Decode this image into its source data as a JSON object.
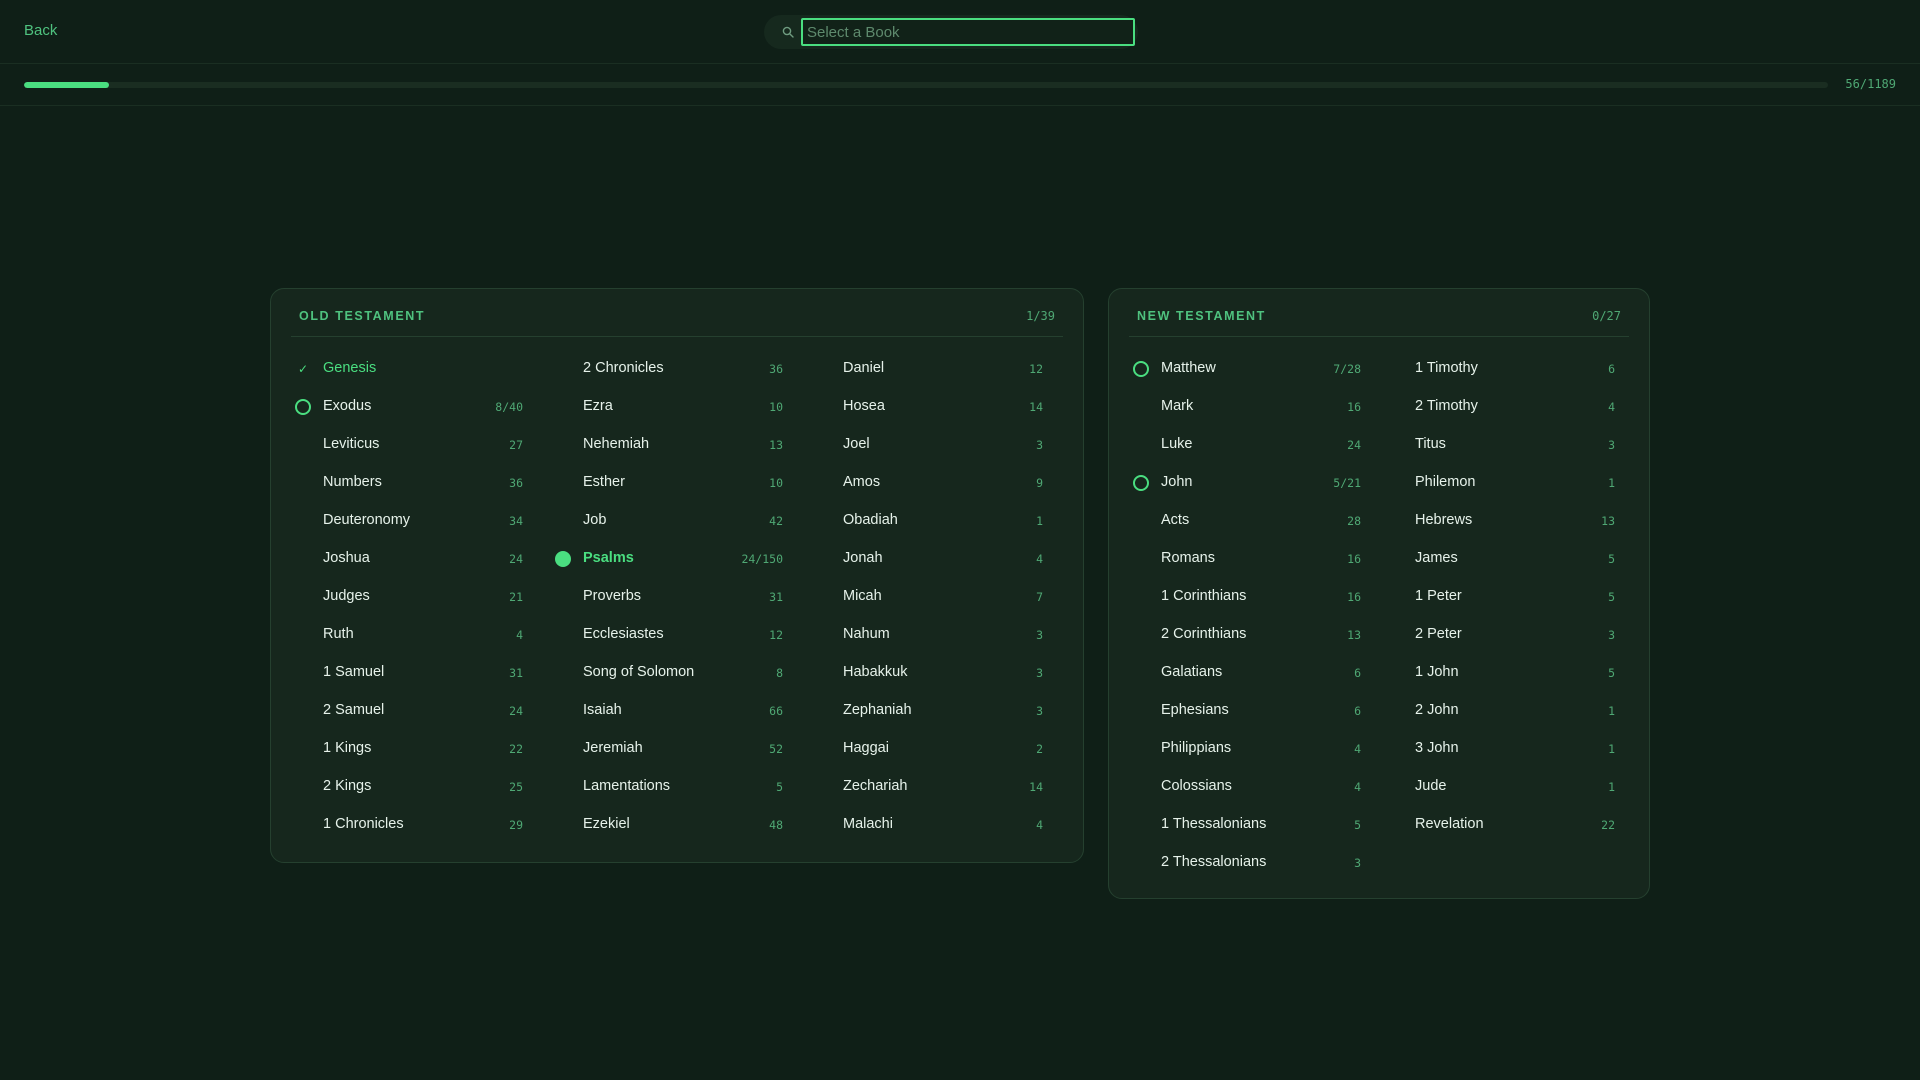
{
  "nav": {
    "back_label": "Back"
  },
  "search": {
    "placeholder": "Select a Book",
    "value": ""
  },
  "progress": {
    "fraction": 0.047,
    "label": "56/1189"
  },
  "colors": {
    "accent": "#4ade80",
    "background": "#0f1f17",
    "panel": "#16271d",
    "muted": "#4fa874"
  },
  "old_testament": {
    "title": "OLD TESTAMENT",
    "count": "1/39",
    "columns": [
      [
        {
          "name": "Genesis",
          "chapters": "",
          "status": "done",
          "status_icon": "check-icon"
        },
        {
          "name": "Exodus",
          "chapters": "8/40",
          "status": "in-progress",
          "status_icon": "ring-icon"
        },
        {
          "name": "Leviticus",
          "chapters": "27",
          "status": "none"
        },
        {
          "name": "Numbers",
          "chapters": "36",
          "status": "none"
        },
        {
          "name": "Deuteronomy",
          "chapters": "34",
          "status": "none"
        },
        {
          "name": "Joshua",
          "chapters": "24",
          "status": "none"
        },
        {
          "name": "Judges",
          "chapters": "21",
          "status": "none"
        },
        {
          "name": "Ruth",
          "chapters": "4",
          "status": "none"
        },
        {
          "name": "1 Samuel",
          "chapters": "31",
          "status": "none"
        },
        {
          "name": "2 Samuel",
          "chapters": "24",
          "status": "none"
        },
        {
          "name": "1 Kings",
          "chapters": "22",
          "status": "none"
        },
        {
          "name": "2 Kings",
          "chapters": "25",
          "status": "none"
        },
        {
          "name": "1 Chronicles",
          "chapters": "29",
          "status": "none"
        }
      ],
      [
        {
          "name": "2 Chronicles",
          "chapters": "36",
          "status": "none"
        },
        {
          "name": "Ezra",
          "chapters": "10",
          "status": "none"
        },
        {
          "name": "Nehemiah",
          "chapters": "13",
          "status": "none"
        },
        {
          "name": "Esther",
          "chapters": "10",
          "status": "none"
        },
        {
          "name": "Job",
          "chapters": "42",
          "status": "none"
        },
        {
          "name": "Psalms",
          "chapters": "24/150",
          "status": "current",
          "status_icon": "dot-icon"
        },
        {
          "name": "Proverbs",
          "chapters": "31",
          "status": "none"
        },
        {
          "name": "Ecclesiastes",
          "chapters": "12",
          "status": "none"
        },
        {
          "name": "Song of Solomon",
          "chapters": "8",
          "status": "none"
        },
        {
          "name": "Isaiah",
          "chapters": "66",
          "status": "none"
        },
        {
          "name": "Jeremiah",
          "chapters": "52",
          "status": "none"
        },
        {
          "name": "Lamentations",
          "chapters": "5",
          "status": "none"
        },
        {
          "name": "Ezekiel",
          "chapters": "48",
          "status": "none"
        }
      ],
      [
        {
          "name": "Daniel",
          "chapters": "12",
          "status": "none"
        },
        {
          "name": "Hosea",
          "chapters": "14",
          "status": "none"
        },
        {
          "name": "Joel",
          "chapters": "3",
          "status": "none"
        },
        {
          "name": "Amos",
          "chapters": "9",
          "status": "none"
        },
        {
          "name": "Obadiah",
          "chapters": "1",
          "status": "none"
        },
        {
          "name": "Jonah",
          "chapters": "4",
          "status": "none"
        },
        {
          "name": "Micah",
          "chapters": "7",
          "status": "none"
        },
        {
          "name": "Nahum",
          "chapters": "3",
          "status": "none"
        },
        {
          "name": "Habakkuk",
          "chapters": "3",
          "status": "none"
        },
        {
          "name": "Zephaniah",
          "chapters": "3",
          "status": "none"
        },
        {
          "name": "Haggai",
          "chapters": "2",
          "status": "none"
        },
        {
          "name": "Zechariah",
          "chapters": "14",
          "status": "none"
        },
        {
          "name": "Malachi",
          "chapters": "4",
          "status": "none"
        }
      ]
    ]
  },
  "new_testament": {
    "title": "NEW TESTAMENT",
    "count": "0/27",
    "columns": [
      [
        {
          "name": "Matthew",
          "chapters": "7/28",
          "status": "in-progress",
          "status_icon": "ring-icon"
        },
        {
          "name": "Mark",
          "chapters": "16",
          "status": "none"
        },
        {
          "name": "Luke",
          "chapters": "24",
          "status": "none"
        },
        {
          "name": "John",
          "chapters": "5/21",
          "status": "in-progress",
          "status_icon": "ring-icon"
        },
        {
          "name": "Acts",
          "chapters": "28",
          "status": "none"
        },
        {
          "name": "Romans",
          "chapters": "16",
          "status": "none"
        },
        {
          "name": "1 Corinthians",
          "chapters": "16",
          "status": "none"
        },
        {
          "name": "2 Corinthians",
          "chapters": "13",
          "status": "none"
        },
        {
          "name": "Galatians",
          "chapters": "6",
          "status": "none"
        },
        {
          "name": "Ephesians",
          "chapters": "6",
          "status": "none"
        },
        {
          "name": "Philippians",
          "chapters": "4",
          "status": "none"
        },
        {
          "name": "Colossians",
          "chapters": "4",
          "status": "none"
        },
        {
          "name": "1 Thessalonians",
          "chapters": "5",
          "status": "none"
        },
        {
          "name": "2 Thessalonians",
          "chapters": "3",
          "status": "none"
        }
      ],
      [
        {
          "name": "1 Timothy",
          "chapters": "6",
          "status": "none"
        },
        {
          "name": "2 Timothy",
          "chapters": "4",
          "status": "none"
        },
        {
          "name": "Titus",
          "chapters": "3",
          "status": "none"
        },
        {
          "name": "Philemon",
          "chapters": "1",
          "status": "none"
        },
        {
          "name": "Hebrews",
          "chapters": "13",
          "status": "none"
        },
        {
          "name": "James",
          "chapters": "5",
          "status": "none"
        },
        {
          "name": "1 Peter",
          "chapters": "5",
          "status": "none"
        },
        {
          "name": "2 Peter",
          "chapters": "3",
          "status": "none"
        },
        {
          "name": "1 John",
          "chapters": "5",
          "status": "none"
        },
        {
          "name": "2 John",
          "chapters": "1",
          "status": "none"
        },
        {
          "name": "3 John",
          "chapters": "1",
          "status": "none"
        },
        {
          "name": "Jude",
          "chapters": "1",
          "status": "none"
        },
        {
          "name": "Revelation",
          "chapters": "22",
          "status": "none"
        }
      ]
    ]
  }
}
